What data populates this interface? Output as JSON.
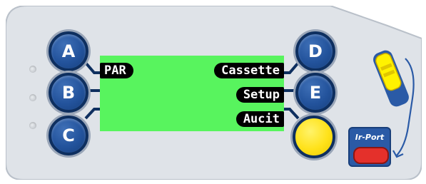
{
  "panel": {
    "body_color": "#dfe3e8",
    "edge_color": "#b9c0c9"
  },
  "display": {
    "background": "#58f45e",
    "softkeys": {
      "a": "PAR",
      "d": "Cassette",
      "e": "Setup",
      "f": "Aucit"
    }
  },
  "buttons": {
    "a": "A",
    "b": "B",
    "c": "C",
    "d": "D",
    "e": "E",
    "enter": {
      "color": "#ffe21a"
    }
  },
  "leds": {
    "count": 3
  },
  "ir_port": {
    "label": "Ir-Port"
  },
  "icons": {
    "cassette": "cassette-insert-icon",
    "insert_arrow": "insert-arrow-icon"
  }
}
